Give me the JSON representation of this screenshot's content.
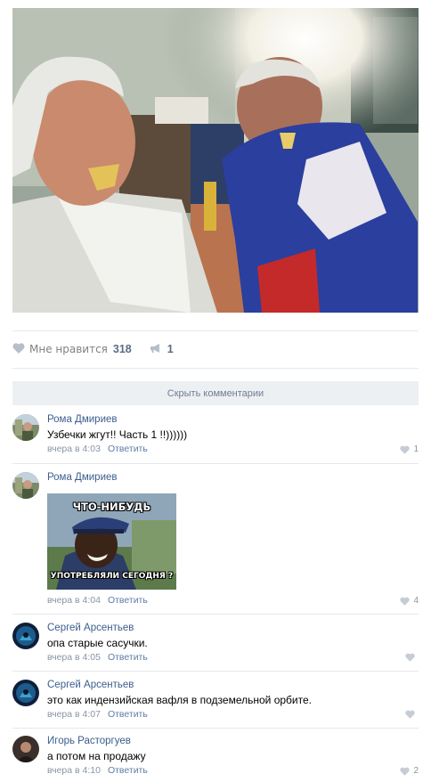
{
  "post": {
    "likes_label": "Мне нравится",
    "likes_count": "318",
    "shares_count": "1"
  },
  "hide_comments_label": "Скрыть комментарии",
  "comments": [
    {
      "author": "Рома Дмириев",
      "text": "Узбечки жгут!! Часть 1 !!))))))",
      "time": "вчера в 4:03",
      "reply": "Ответить",
      "likes": "1"
    },
    {
      "author": "Рома Дмириев",
      "meme_top": "ЧТО-НИБУДЬ",
      "meme_bottom": "УПОТРЕБЛЯЛИ СЕГОДНЯ ?",
      "time": "вчера в 4:04",
      "reply": "Ответить",
      "likes": "4"
    },
    {
      "author": "Сергей Арсентьев",
      "text": "опа старые сасучки.",
      "time": "вчера в 4:05",
      "reply": "Ответить",
      "likes": ""
    },
    {
      "author": "Сергей Арсентьев",
      "text": "это как индензийская вафля в подземельной орбите.",
      "time": "вчера в 4:07",
      "reply": "Ответить",
      "likes": ""
    },
    {
      "author": "Игорь Расторгуев",
      "text": "а потом на продажу",
      "time": "вчера в 4:10",
      "reply": "Ответить",
      "likes": "2"
    }
  ]
}
